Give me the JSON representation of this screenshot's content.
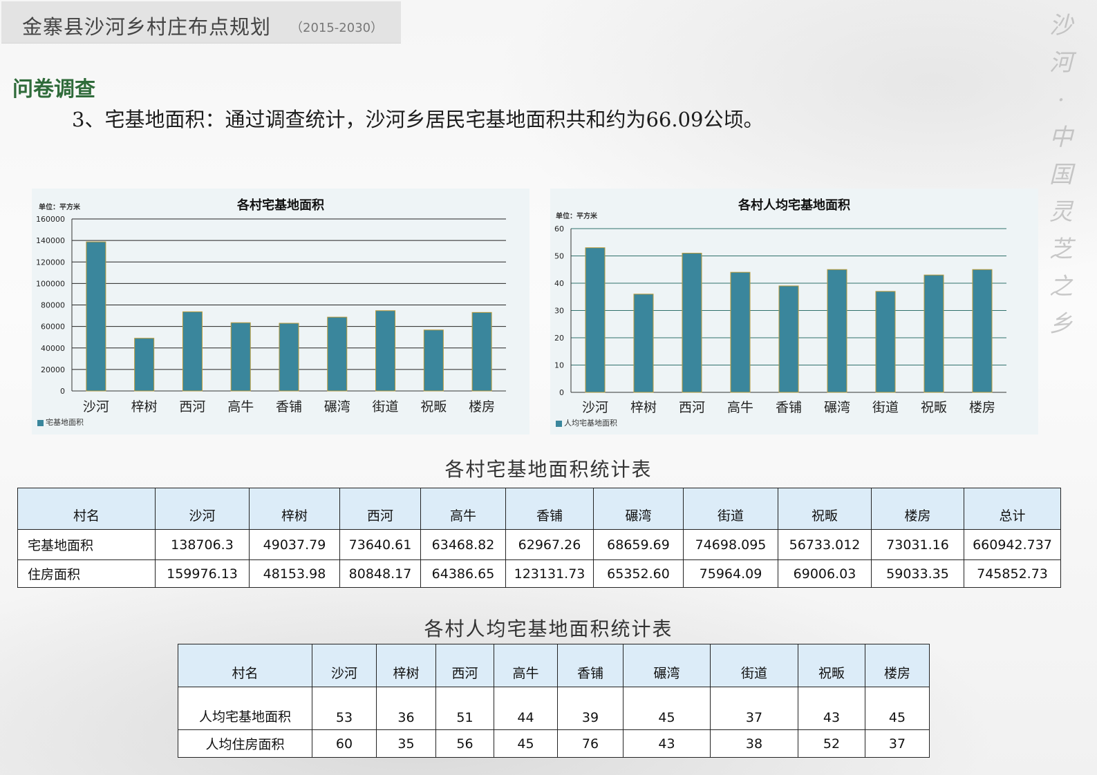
{
  "header": {
    "title": "金寨县沙河乡村庄布点规划",
    "years": "（2015-2030）"
  },
  "motto": [
    "沙",
    "河",
    "·",
    "中",
    "国",
    "灵",
    "芝",
    "之",
    "乡"
  ],
  "section_title": "问卷调查",
  "intro": "3、宅基地面积：通过调查统计，沙河乡居民宅基地面积共和约为66.09公顷。",
  "colors": {
    "bar": "#3a869c",
    "bar_edge": "#b89a3a",
    "panel": "#eef4f6",
    "header_cell": "#dcecf8",
    "section_title": "#2f6b3a"
  },
  "chart_data": [
    {
      "type": "bar",
      "title": "各村宅基地面积",
      "unit_label": "单位：平方米",
      "categories": [
        "沙河",
        "梓树",
        "西河",
        "高牛",
        "香铺",
        "碾湾",
        "街道",
        "祝畈",
        "楼房"
      ],
      "series": [
        {
          "name": "宅基地面积",
          "values": [
            138706.3,
            49037.79,
            73640.61,
            63468.82,
            62967.26,
            68659.69,
            74698.095,
            56733.012,
            73031.16
          ]
        }
      ],
      "ylim": [
        0,
        160000
      ],
      "yticks": [
        "160000",
        "140000",
        "120000",
        "100000",
        "80000",
        "60000",
        "40000",
        "20000",
        "0"
      ],
      "grid": true,
      "legend_position": "bottom-left"
    },
    {
      "type": "bar",
      "title": "各村人均宅基地面积",
      "unit_label": "单位：平方米",
      "categories": [
        "沙河",
        "梓树",
        "西河",
        "高牛",
        "香铺",
        "碾湾",
        "街道",
        "祝畈",
        "楼房"
      ],
      "series": [
        {
          "name": "人均宅基地面积",
          "values": [
            53,
            36,
            51,
            44,
            39,
            45,
            37,
            43,
            45
          ]
        }
      ],
      "ylim": [
        0,
        60
      ],
      "yticks": [
        "60",
        "50",
        "40",
        "30",
        "20",
        "10",
        "0"
      ],
      "grid": true,
      "legend_position": "bottom-left"
    }
  ],
  "table1": {
    "title": "各村宅基地面积统计表",
    "header": [
      "村名",
      "沙河",
      "梓树",
      "西河",
      "高牛",
      "香铺",
      "碾湾",
      "街道",
      "祝畈",
      "楼房",
      "总计"
    ],
    "rows": [
      [
        "宅基地面积",
        "138706.3",
        "49037.79",
        "73640.61",
        "63468.82",
        "62967.26",
        "68659.69",
        "74698.095",
        "56733.012",
        "73031.16",
        "660942.737"
      ],
      [
        "住房面积",
        "159976.13",
        "48153.98",
        "80848.17",
        "64386.65",
        "123131.73",
        "65352.60",
        "75964.09",
        "69006.03",
        "59033.35",
        "745852.73"
      ]
    ]
  },
  "table2": {
    "title": "各村人均宅基地面积统计表",
    "header": [
      "村名",
      "沙河",
      "梓树",
      "西河",
      "高牛",
      "香铺",
      "碾湾",
      "街道",
      "祝畈",
      "楼房"
    ],
    "rows": [
      [
        "人均宅基地面积",
        "53",
        "36",
        "51",
        "44",
        "39",
        "45",
        "37",
        "43",
        "45"
      ],
      [
        "人均住房面积",
        "60",
        "35",
        "56",
        "45",
        "76",
        "43",
        "38",
        "52",
        "37"
      ]
    ]
  }
}
